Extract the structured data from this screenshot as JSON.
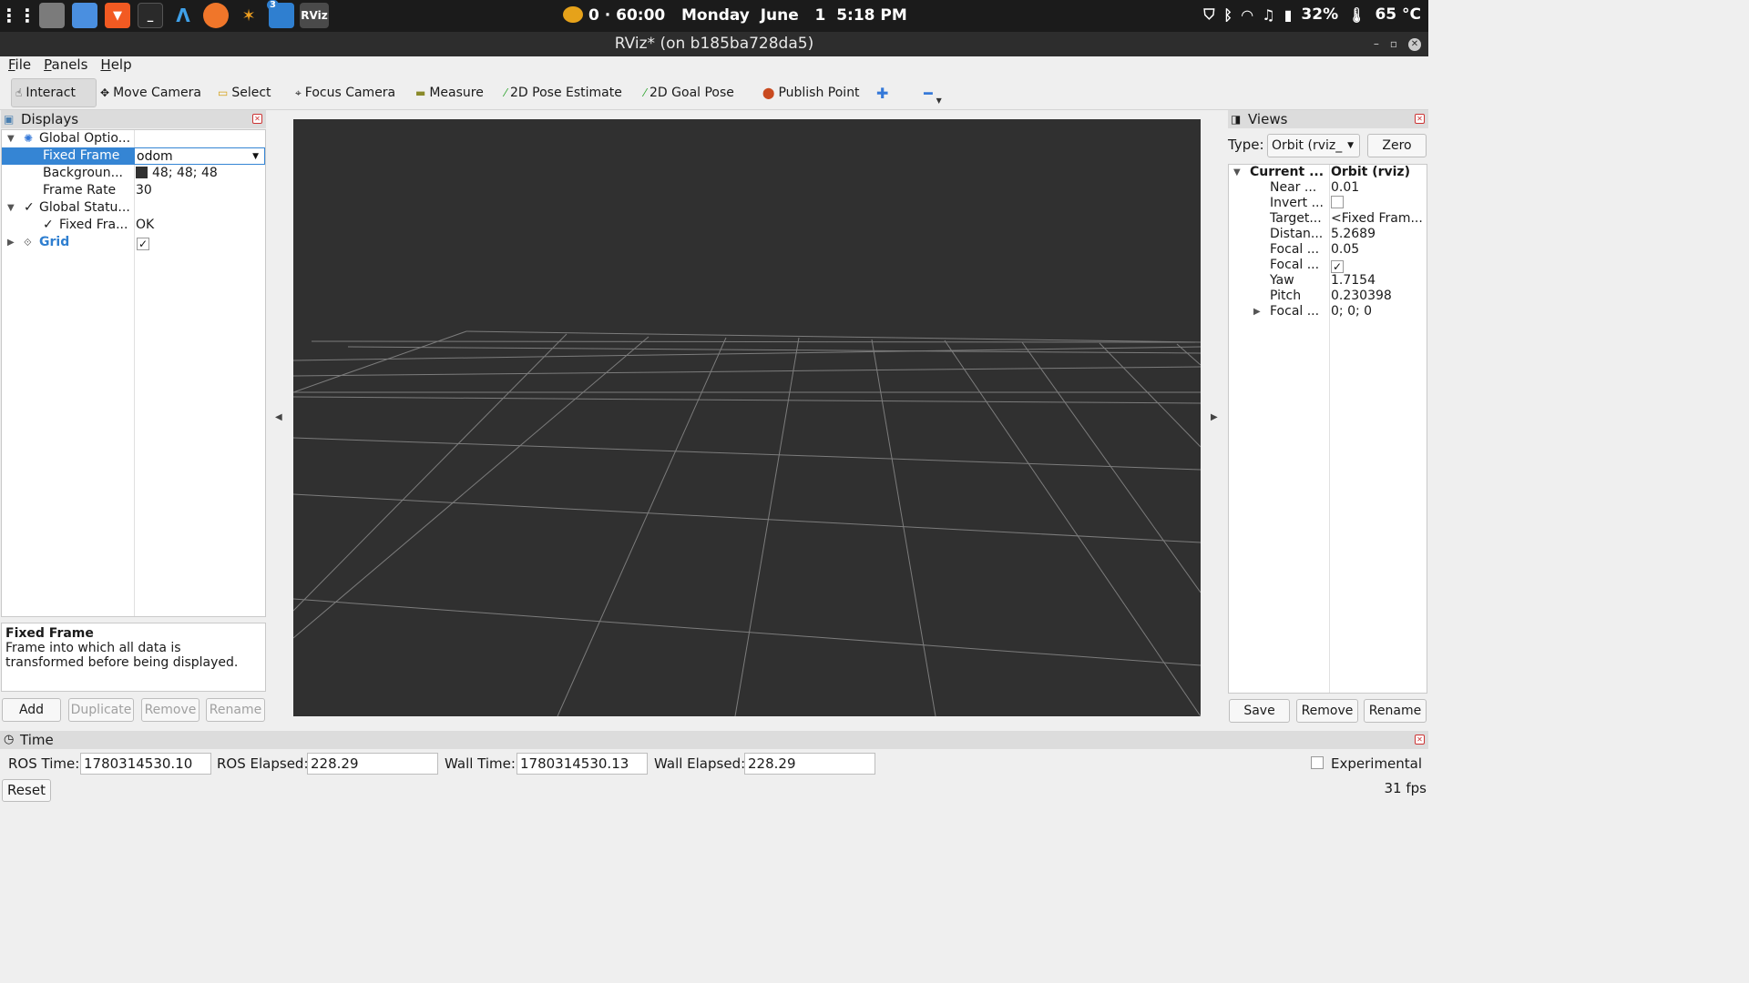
{
  "taskbar": {
    "apps": [
      "apps-grid",
      "files",
      "text-editor",
      "brave",
      "terminal",
      "arduino-ide",
      "firefox",
      "bugs",
      "vscode",
      "rviz"
    ],
    "vscode_badge": "3",
    "rviz_label": "RViz",
    "clock": "0 · 60:00   Monday  June   1  5:18 PM",
    "battery": "32%",
    "temperature": "65 °C"
  },
  "window": {
    "title": "RViz* (on b185ba728da5)"
  },
  "menu": [
    "File",
    "Panels",
    "Help"
  ],
  "toolbar": {
    "interact": "Interact",
    "move_camera": "Move Camera",
    "select": "Select",
    "focus_camera": "Focus Camera",
    "measure": "Measure",
    "pose_estimate": "2D Pose Estimate",
    "goal_pose": "2D Goal Pose",
    "publish_point": "Publish Point"
  },
  "displays": {
    "title": "Displays",
    "rows": {
      "global_options": "Global Optio...",
      "fixed_frame_k": "Fixed Frame",
      "fixed_frame_v": "odom",
      "background_k": "Backgroun...",
      "background_v": "48; 48; 48",
      "frame_rate_k": "Frame Rate",
      "frame_rate_v": "30",
      "global_status": "Global Statu...",
      "fixed_fra_k": "Fixed Fra...",
      "fixed_fra_v": "OK",
      "grid": "Grid"
    },
    "background_color": "#303030",
    "description_title": "Fixed Frame",
    "description_text": "Frame into which all data is transformed before being displayed.",
    "buttons": {
      "add": "Add",
      "duplicate": "Duplicate",
      "remove": "Remove",
      "rename": "Rename"
    }
  },
  "views": {
    "title": "Views",
    "type_label": "Type:",
    "type_value": "Orbit (rviz_",
    "zero": "Zero",
    "rows": {
      "current_k": "Current ...",
      "current_v": "Orbit (rviz)",
      "near_k": "Near ...",
      "near_v": "0.01",
      "invert_k": "Invert ...",
      "target_k": "Target...",
      "target_v": "<Fixed Fram...",
      "distance_k": "Distan...",
      "distance_v": "5.2689",
      "focal1_k": "Focal ...",
      "focal1_v": "0.05",
      "focal2_k": "Focal ...",
      "yaw_k": "Yaw",
      "yaw_v": "1.7154",
      "pitch_k": "Pitch",
      "pitch_v": "0.230398",
      "focal3_k": "Focal ...",
      "focal3_v": "0; 0; 0"
    },
    "buttons": {
      "save": "Save",
      "remove": "Remove",
      "rename": "Rename"
    }
  },
  "time": {
    "title": "Time",
    "ros_time_label": "ROS Time:",
    "ros_time": "1780314530.10",
    "ros_elapsed_label": "ROS Elapsed:",
    "ros_elapsed": "228.29",
    "wall_time_label": "Wall Time:",
    "wall_time": "1780314530.13",
    "wall_elapsed_label": "Wall Elapsed:",
    "wall_elapsed": "228.29",
    "experimental": "Experimental",
    "reset": "Reset",
    "fps": "31 fps"
  }
}
